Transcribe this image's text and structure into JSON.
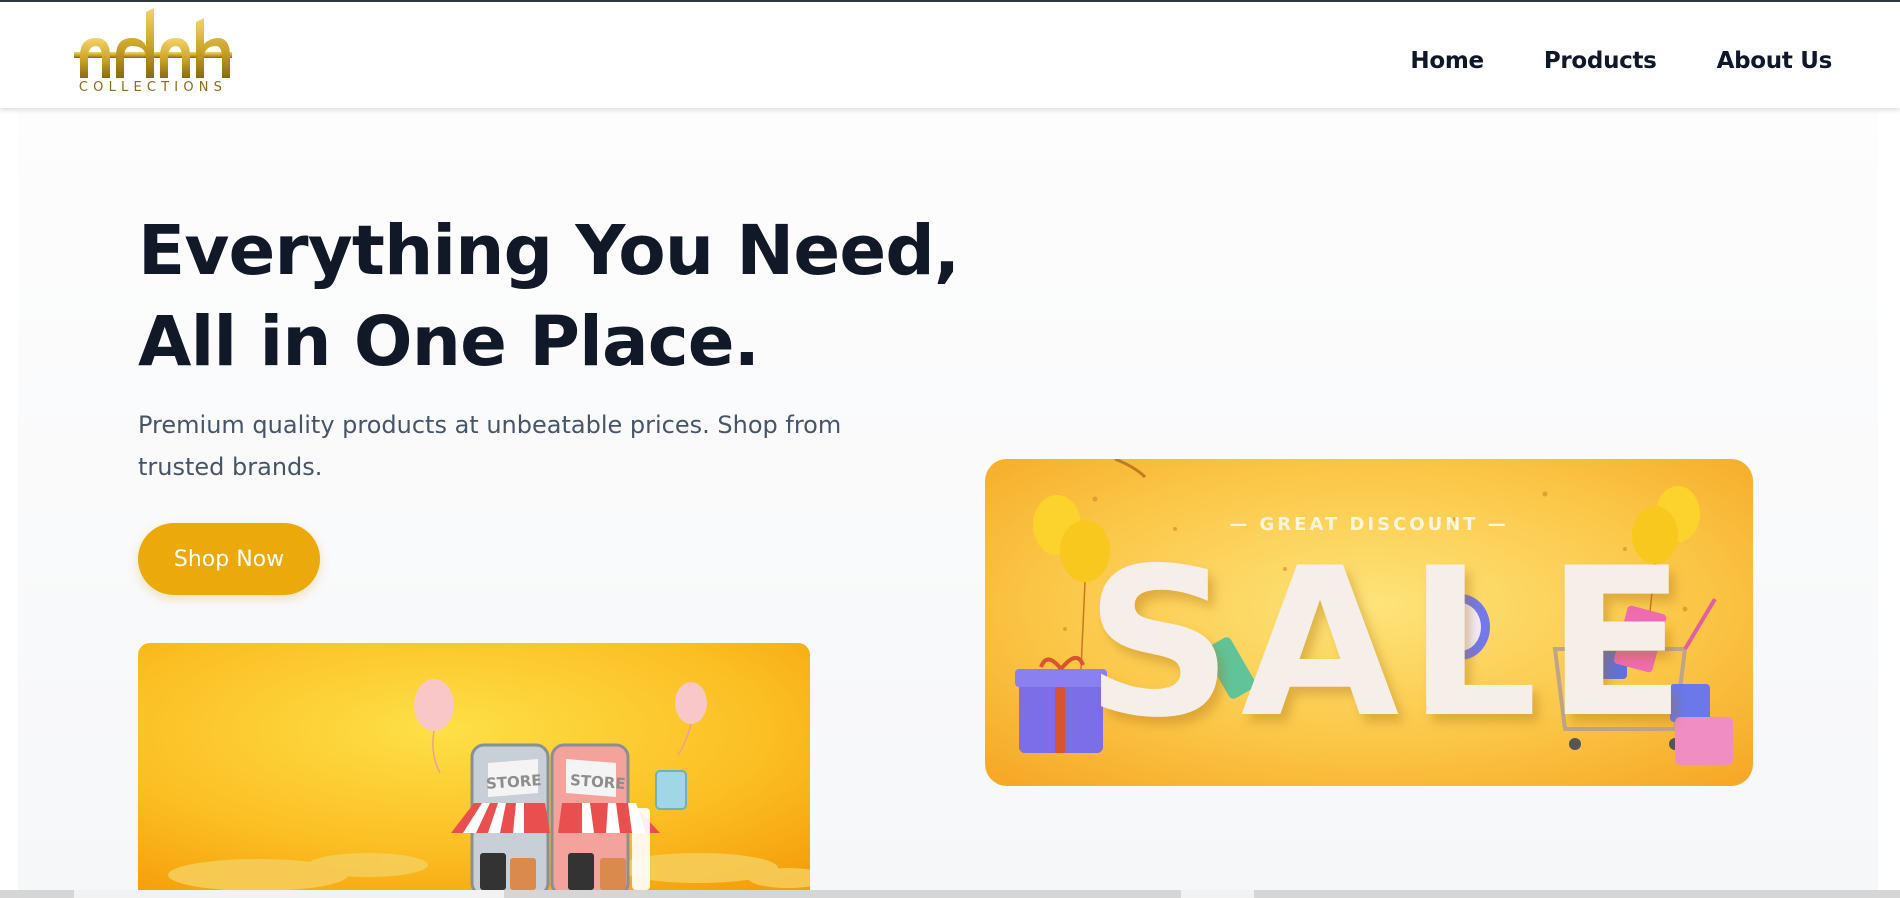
{
  "window": {
    "title": "aadah COLLECTIONS"
  },
  "brand": {
    "logo_text": "aadah",
    "caption": "COLLECTIONS",
    "gold": "#c9a227"
  },
  "nav": {
    "items": [
      {
        "label": "Home",
        "icon": ""
      },
      {
        "label": "Products",
        "icon": ""
      },
      {
        "label": "About Us",
        "icon": ""
      }
    ]
  },
  "hero": {
    "headline_line1": "Everything You Need,",
    "headline_line2": "All in One Place.",
    "subtext": "Premium quality products at unbeatable prices. Shop from trusted brands.",
    "cta_label": "Shop Now",
    "cta_color": "#eba90b"
  },
  "banners": {
    "left": {
      "store_label_1": "STORE",
      "store_label_2": "STORE",
      "image": "online-store-illustration"
    },
    "right": {
      "subtitle": "— GREAT DISCOUNT —",
      "headline": "SALE",
      "image": "sale-promo-illustration"
    }
  },
  "colors": {
    "heading": "#111827",
    "body_text": "#475569",
    "banner_orange": "#fbbf3f"
  }
}
